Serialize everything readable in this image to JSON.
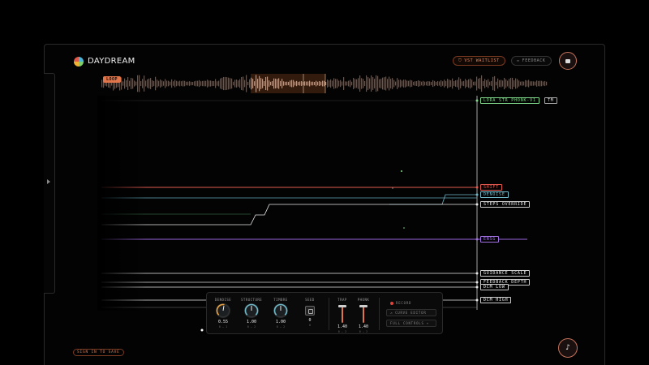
{
  "app": {
    "name": "DAYDREAM"
  },
  "header": {
    "waitlist_label": "VST WAITLIST",
    "feedback_label": "FEEDBACK",
    "screen_icon": "screen-icon"
  },
  "waveform": {
    "loop_label": "LOOP"
  },
  "params": {
    "lora": "LORA STR PHONK-V1",
    "lora_suffix": "TM",
    "shift": "SHIFT",
    "denoise": "DENOISE",
    "steps_override": "STEPS OVERRIDE",
    "ensg": "ENSG",
    "guidance_scale": "GUIDANCE SCALE",
    "feedback_depth": "FEEDBACK DEPTH",
    "dcm_low": "DCM LOW",
    "dcm_high": "DCM HIGH"
  },
  "controls": {
    "denoise": {
      "label": "DENOISE",
      "value": "0.55",
      "range": "0 — 1"
    },
    "structure": {
      "label": "STRUCTURE",
      "value": "1.00",
      "range": "0 — 2"
    },
    "timbre": {
      "label": "TIMBRE",
      "value": "1.00",
      "range": "0 — 2"
    },
    "seed": {
      "label": "SEED",
      "value": "0",
      "range": "0"
    },
    "trap": {
      "label": "TRAP",
      "value": "1.40",
      "range": "0 — 2"
    },
    "phonk": {
      "label": "PHONK",
      "value": "1.40",
      "range": "0 — 2"
    },
    "record_label": "RECORD",
    "curve_editor_label": "CURVE EDITOR",
    "full_controls_label": "FULL CONTROLS"
  },
  "footer": {
    "sign_in_label": "SIGN IN TO SAVE",
    "music_icon": "music-note-icon"
  },
  "colors": {
    "accent": "#e0744a",
    "lora": "#7fd88a",
    "shift": "#e2584e",
    "denoise": "#6fb8c8",
    "ensg": "#a070e0",
    "white_line": "#e8e8e8"
  }
}
